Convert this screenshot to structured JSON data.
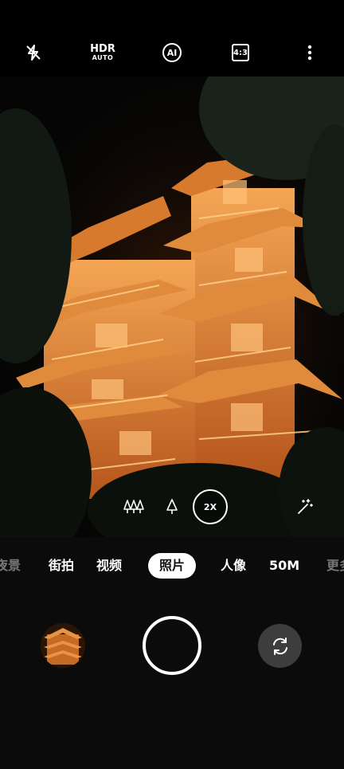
{
  "topbar": {
    "flash_icon": "flash-off-icon",
    "hdr_label": "HDR",
    "hdr_sub": "AUTO",
    "ai_label": "AI",
    "ratio_label": "4:3",
    "more_icon": "more-vertical-icon"
  },
  "viewfinder": {
    "subject": "illuminated-pagoda-night"
  },
  "controls": {
    "zoom_label": "2X",
    "wide_icon": "trees-wide-icon",
    "tele_icon": "tree-icon",
    "magic_icon": "magic-wand-icon"
  },
  "modes": [
    {
      "label": "夜景"
    },
    {
      "label": "街拍"
    },
    {
      "label": "视频"
    },
    {
      "label": "照片"
    },
    {
      "label": "人像"
    },
    {
      "label": "50M"
    },
    {
      "label": "更多"
    }
  ],
  "active_mode": "照片",
  "bottom": {
    "switch_icon": "switch-camera-icon"
  },
  "colors": {
    "background": "#0b0b0b",
    "shutter_ring": "#ffffff",
    "switch_bg": "#3d3d3d",
    "temple_glow": "#e08a3c"
  }
}
